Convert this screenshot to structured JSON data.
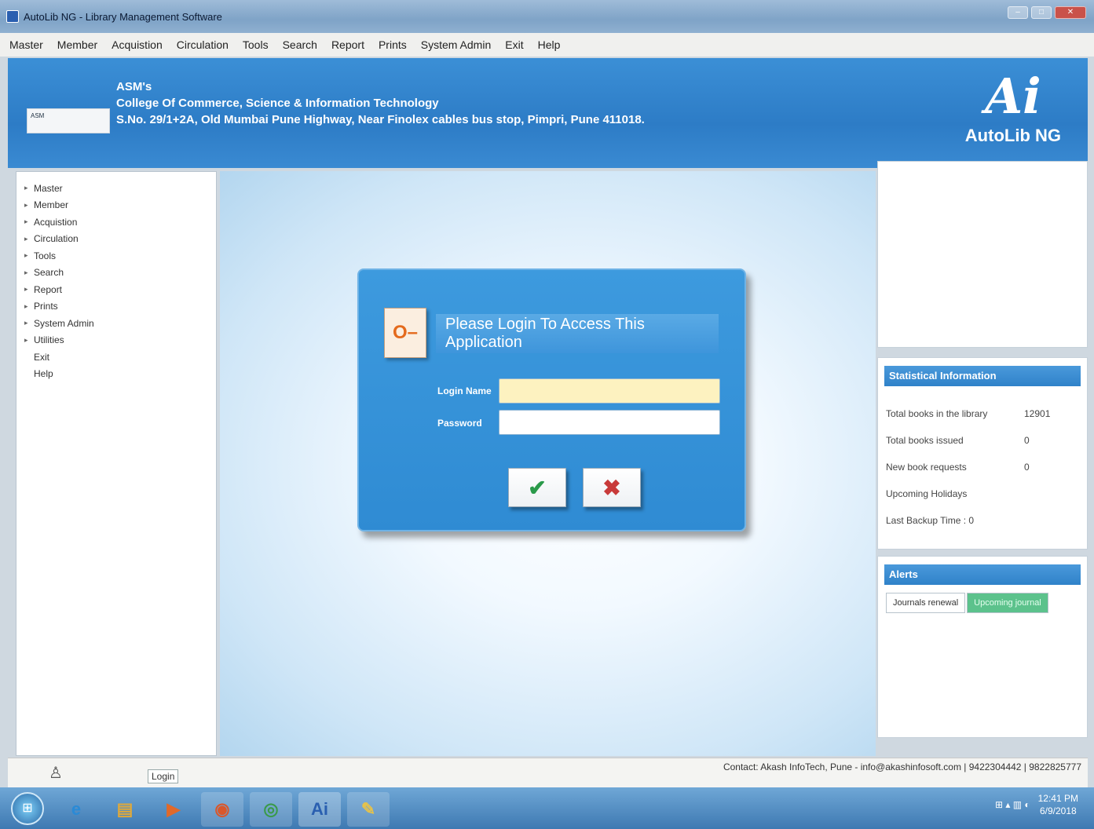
{
  "window": {
    "title": "AutoLib NG - Library Management Software",
    "min_label": "–",
    "max_label": "□",
    "close_label": "✕"
  },
  "menu": {
    "items": [
      "Master",
      "Member",
      "Acquistion",
      "Circulation",
      "Tools",
      "Search",
      "Report",
      "Prints",
      "System Admin",
      "Exit",
      "Help"
    ]
  },
  "header": {
    "college_prefix": "ASM's",
    "college_name": "College Of Commerce, Science & Information Technology",
    "college_address": "S.No. 29/1+2A, Old Mumbai Pune Highway, Near Finolex cables bus stop, Pimpri, Pune 411018.",
    "logo_text": "ASM",
    "brand_mark": "Ai",
    "brand_name": "AutoLib NG"
  },
  "sidebar": {
    "items": [
      {
        "label": "Master",
        "expandable": true
      },
      {
        "label": "Member",
        "expandable": true
      },
      {
        "label": "Acquistion",
        "expandable": true
      },
      {
        "label": "Circulation",
        "expandable": true
      },
      {
        "label": "Tools",
        "expandable": true
      },
      {
        "label": "Search",
        "expandable": true
      },
      {
        "label": "Report",
        "expandable": true
      },
      {
        "label": "Prints",
        "expandable": true
      },
      {
        "label": "System Admin",
        "expandable": true
      },
      {
        "label": "Utilities",
        "expandable": true
      },
      {
        "label": "Exit",
        "expandable": false
      },
      {
        "label": "Help",
        "expandable": false
      }
    ]
  },
  "login": {
    "heading": "Please Login To Access This Application",
    "key_glyph": "O–",
    "login_name_label": "Login Name",
    "login_name_value": "",
    "password_label": "Password",
    "password_value": "",
    "ok_glyph": "✔",
    "cancel_glyph": "✖"
  },
  "stats": {
    "title": "Statistical Information",
    "rows": [
      {
        "label": "Total books in the library",
        "value": "12901"
      },
      {
        "label": "Total books issued",
        "value": "0"
      },
      {
        "label": "New book requests",
        "value": "0"
      },
      {
        "label": "Upcoming Holidays",
        "value": ""
      },
      {
        "label": "Last Backup Time : 0",
        "value": ""
      }
    ]
  },
  "alerts": {
    "title": "Alerts",
    "tabs": [
      "Journals renewal",
      "Upcoming journal"
    ]
  },
  "status": {
    "user_glyph": "♙",
    "login_label": "Login",
    "contact": "Contact: Akash InfoTech, Pune - info@akashinfosoft.com | 9422304442 | 9822825777"
  },
  "taskbar": {
    "start_glyph": "⊞",
    "apps": [
      {
        "name": "internet-explorer",
        "glyph": "e",
        "color": "#2a8ad6"
      },
      {
        "name": "file-explorer",
        "glyph": "▤",
        "color": "#e0a93a"
      },
      {
        "name": "media-player",
        "glyph": "▶",
        "color": "#e0692a"
      },
      {
        "name": "firefox",
        "glyph": "◉",
        "color": "#d9572b"
      },
      {
        "name": "chrome",
        "glyph": "◎",
        "color": "#3a9a4a"
      },
      {
        "name": "autolib",
        "glyph": "Ai",
        "color": "#2a5fb0"
      },
      {
        "name": "paint",
        "glyph": "✎",
        "color": "#e6c24a"
      }
    ],
    "tray_icons": "⊞ ▴ ▥ ◐",
    "time": "12:41 PM",
    "date": "6/9/2018"
  },
  "colors": {
    "header_blue": "#2d7cc6",
    "dialog_blue": "#2f8bd3",
    "active_field": "#fdf2c0",
    "ok_green": "#2a9a4a",
    "cancel_red": "#c83a3a"
  }
}
